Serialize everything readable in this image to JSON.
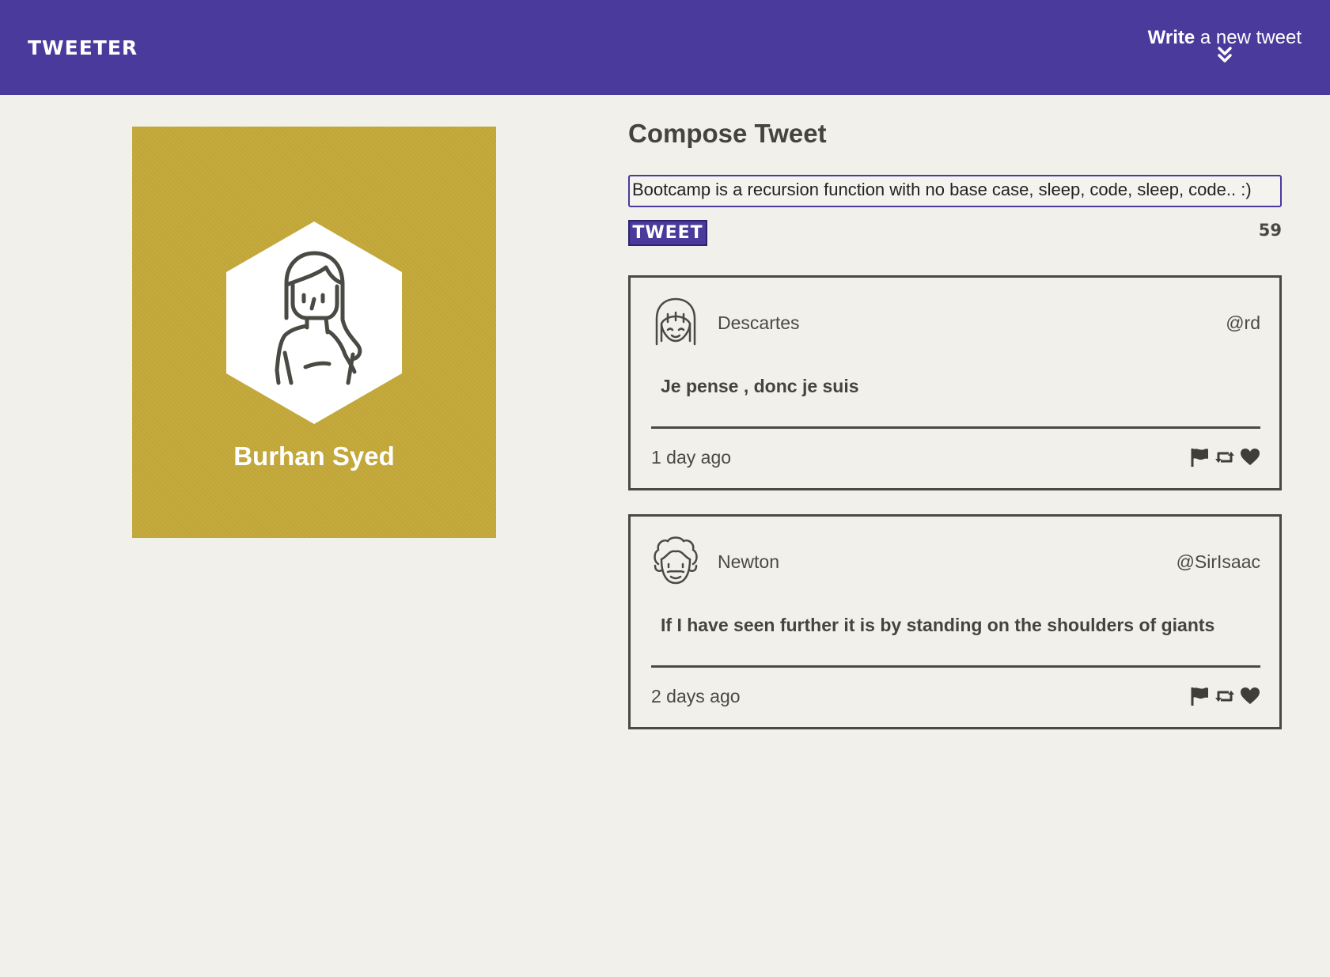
{
  "nav": {
    "brand": "TWEETER",
    "compose_bold": "Write",
    "compose_rest": " a new tweet"
  },
  "profile": {
    "name": "Burhan Syed",
    "background_color": "#c4a83a"
  },
  "compose": {
    "title": "Compose Tweet",
    "text": "Bootcamp is a recursion function with no base case, sleep, code, sleep, code.. :)",
    "button_label": "TWEET",
    "counter": "59"
  },
  "tweets": [
    {
      "author": "Descartes",
      "handle": "@rd",
      "content": "Je pense , donc je suis",
      "time": "1 day ago",
      "avatar_icon": "girl-avatar-icon"
    },
    {
      "author": "Newton",
      "handle": "@SirIsaac",
      "content": "If I have seen further it is by standing on the shoulders of giants",
      "time": "2 days ago",
      "avatar_icon": "curly-hair-man-avatar-icon"
    }
  ],
  "actions": [
    "flag-icon",
    "retweet-icon",
    "heart-icon"
  ],
  "colors": {
    "accent": "#4a3a9b",
    "background": "#f1f0ea",
    "text": "#4a4a44"
  }
}
